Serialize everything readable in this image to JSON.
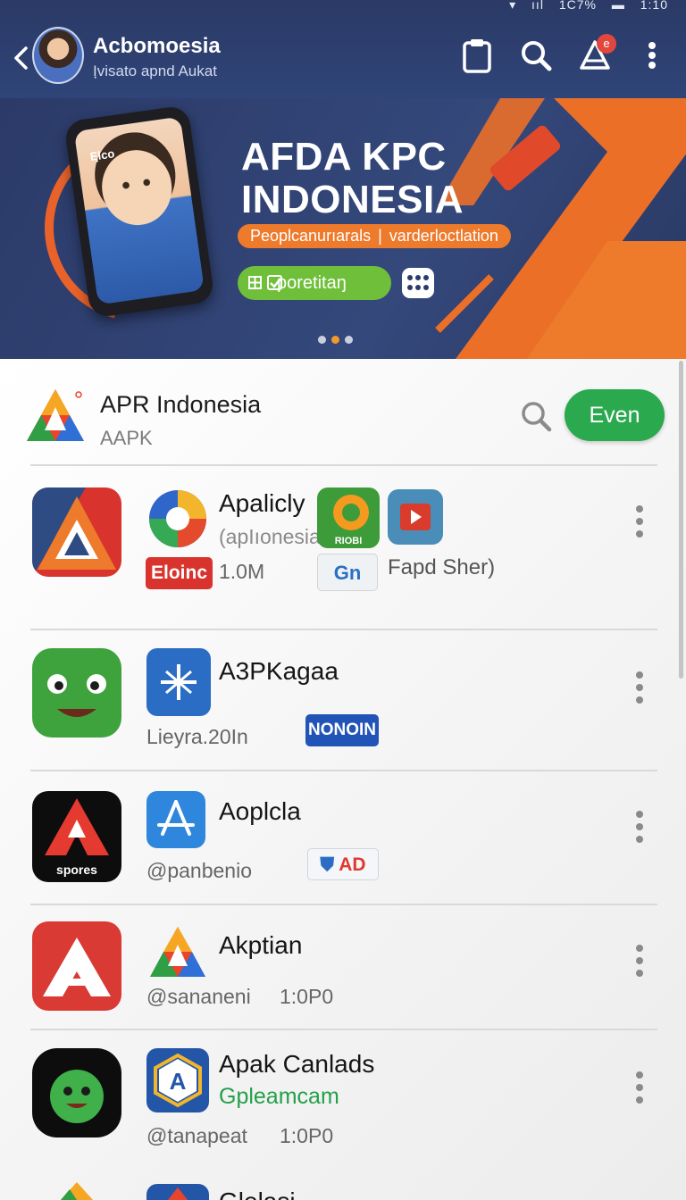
{
  "status_bar": {
    "battery": "1C7%",
    "time": "1:10"
  },
  "header": {
    "title": "Acbomoesia",
    "subtitle": "Iฺvisato apnd Aukat"
  },
  "banner": {
    "phone_label": "Eฺlco",
    "title_line1": "AFDA KPC",
    "title_line2": "INDONESIA",
    "pill_left": "Peoplcanurıarals",
    "pill_sep": "|",
    "pill_right": "varderloctlation",
    "cta_label": "poretitaŋ"
  },
  "list_header": {
    "title": "APR Indonesia",
    "subtitle": "AAPK",
    "button_label": "Even"
  },
  "rows": [
    {
      "title": "Apalicly",
      "subtitle": "(apIıonesia",
      "badge_left": "Eloinc",
      "meta": "1.0M",
      "badge_small": "RIOBI",
      "badge_gn": "Gn",
      "extra": "Fapd Sher)"
    },
    {
      "title": "A3PKagaa",
      "meta": "Lieyra.20In",
      "badge": "NONOIN"
    },
    {
      "title": "Aoplcla",
      "meta": "@panbenio",
      "badge": "AD",
      "icon_caption": "spores"
    },
    {
      "title": "Akptian",
      "meta": "@sananeni",
      "meta2": "1:0P0"
    },
    {
      "title": "Apak Canlads",
      "green": "Gpleamcam",
      "meta": "@tanapeat",
      "meta2": "1:0P0"
    },
    {
      "title": "Glelasi"
    }
  ],
  "colors": {
    "accent_green": "#2aa94f",
    "navy": "#2b3a68",
    "orange": "#ee7a2c"
  }
}
